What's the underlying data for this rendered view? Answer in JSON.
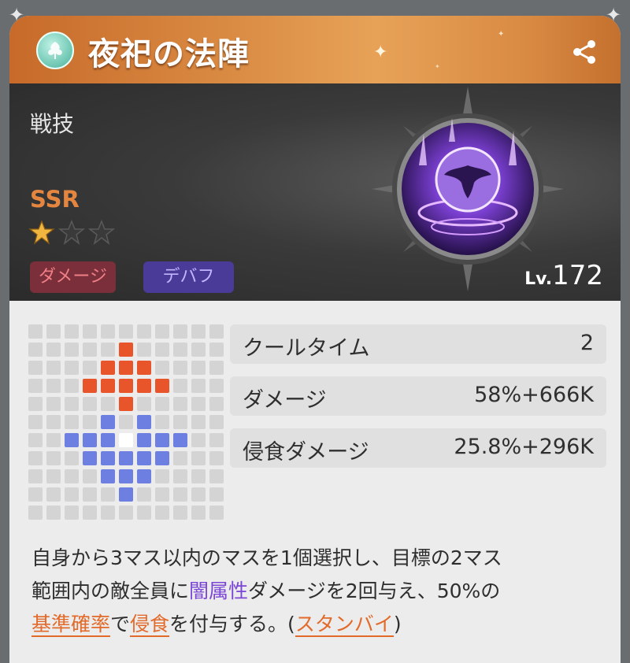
{
  "skill": {
    "title": "夜祀の法陣",
    "type_label": "戦技",
    "rarity": "SSR",
    "stars_filled": 1,
    "stars_total": 3,
    "tags": [
      "ダメージ",
      "デバフ"
    ],
    "level_prefix": "Lv.",
    "level": "172"
  },
  "stats": [
    {
      "label": "クールタイム",
      "value": "2"
    },
    {
      "label": "ダメージ",
      "value": "58%+666K"
    },
    {
      "label": "侵食ダメージ",
      "value": "25.8%+296K"
    }
  ],
  "description": {
    "line1": "自身から3マス以内のマスを1個選択し、目標の2マス",
    "line2_a": "範囲内の敵全員に",
    "line2_kw": "闇属性",
    "line2_b": "ダメージを2回与え、50%の",
    "line3_kw1": "基準確率",
    "line3_a": "で",
    "line3_kw2": "侵食",
    "line3_b": "を付与する。(",
    "line3_kw3": "スタンバイ",
    "line3_c": ")"
  },
  "range_grid": {
    "rows": 11,
    "cols": 11,
    "red_cells": [
      [
        1,
        5
      ],
      [
        2,
        4
      ],
      [
        2,
        5
      ],
      [
        2,
        6
      ],
      [
        3,
        3
      ],
      [
        3,
        4
      ],
      [
        3,
        5
      ],
      [
        3,
        6
      ],
      [
        3,
        7
      ],
      [
        4,
        5
      ]
    ],
    "blue_cells": [
      [
        5,
        4
      ],
      [
        5,
        6
      ],
      [
        6,
        2
      ],
      [
        6,
        3
      ],
      [
        6,
        4
      ],
      [
        6,
        6
      ],
      [
        6,
        7
      ],
      [
        6,
        8
      ],
      [
        7,
        3
      ],
      [
        7,
        4
      ],
      [
        7,
        5
      ],
      [
        7,
        6
      ],
      [
        7,
        7
      ],
      [
        8,
        4
      ],
      [
        8,
        5
      ],
      [
        8,
        6
      ],
      [
        9,
        5
      ]
    ],
    "self_cell": [
      6,
      5
    ]
  },
  "icons": {
    "header_icon": "tree-emblem-icon",
    "share": "share-icon",
    "corner": "sparkle-corner-icon",
    "skill_art": "dark-phoenix-emblem"
  },
  "colors": {
    "header_orange": "#d98a42",
    "rarity_orange": "#e58640",
    "damage_tag": "#7a2f3a",
    "debuff_tag": "#4a3b98",
    "attack_red": "#e8552b",
    "range_blue": "#6d7fe0",
    "keyword_purple": "#7b46d6",
    "keyword_orange": "#e26a2a"
  }
}
